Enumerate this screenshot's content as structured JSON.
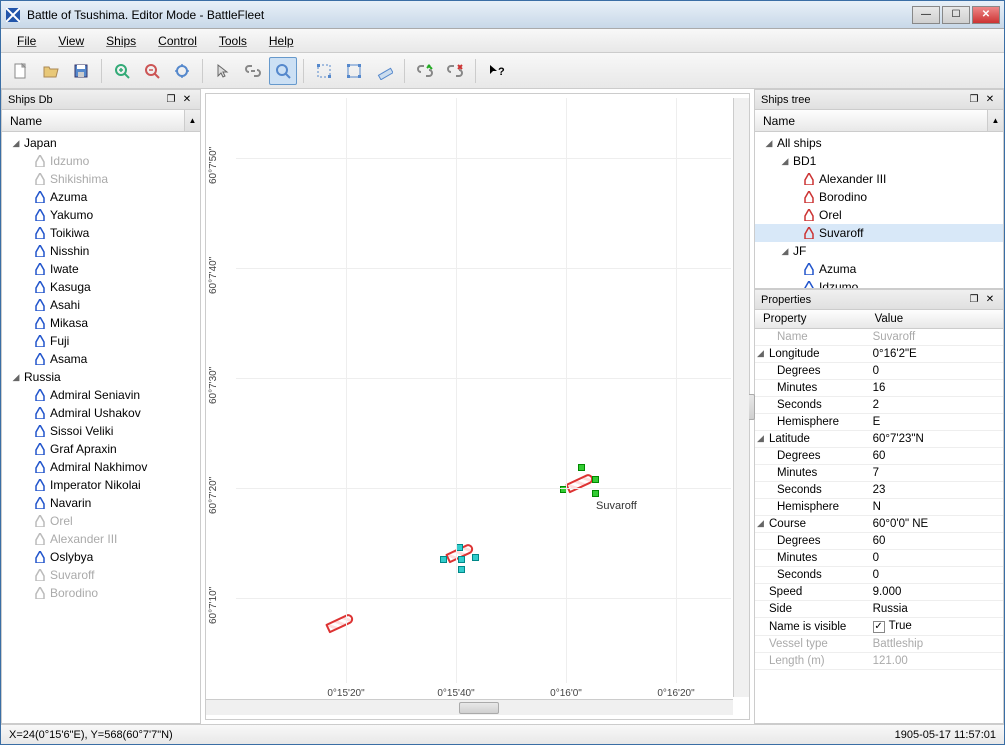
{
  "window": {
    "title": "Battle of Tsushima. Editor Mode - BattleFleet"
  },
  "menu": [
    "File",
    "View",
    "Ships",
    "Control",
    "Tools",
    "Help"
  ],
  "panels": {
    "ships_db": "Ships Db",
    "ships_tree": "Ships tree",
    "properties": "Properties",
    "col_name": "Name",
    "col_property": "Property",
    "col_value": "Value"
  },
  "ships_db": {
    "groups": [
      {
        "name": "Japan",
        "ships": [
          {
            "name": "Idzumo",
            "dim": true
          },
          {
            "name": "Shikishima",
            "dim": true
          },
          {
            "name": "Azuma",
            "dim": false
          },
          {
            "name": "Yakumo",
            "dim": false
          },
          {
            "name": "Toikiwa",
            "dim": false
          },
          {
            "name": "Nisshin",
            "dim": false
          },
          {
            "name": "Iwate",
            "dim": false
          },
          {
            "name": "Kasuga",
            "dim": false
          },
          {
            "name": "Asahi",
            "dim": false
          },
          {
            "name": "Mikasa",
            "dim": false
          },
          {
            "name": "Fuji",
            "dim": false
          },
          {
            "name": "Asama",
            "dim": false
          }
        ]
      },
      {
        "name": "Russia",
        "ships": [
          {
            "name": "Admiral Seniavin",
            "dim": false
          },
          {
            "name": "Admiral Ushakov",
            "dim": false
          },
          {
            "name": "Sissoi Veliki",
            "dim": false
          },
          {
            "name": "Graf Apraxin",
            "dim": false
          },
          {
            "name": "Admiral Nakhimov",
            "dim": false
          },
          {
            "name": "Imperator Nikolai",
            "dim": false
          },
          {
            "name": "Navarin",
            "dim": false
          },
          {
            "name": "Orel",
            "dim": true
          },
          {
            "name": "Alexander III",
            "dim": true
          },
          {
            "name": "Oslybya",
            "dim": false
          },
          {
            "name": "Suvaroff",
            "dim": true
          },
          {
            "name": "Borodino",
            "dim": true
          }
        ]
      }
    ]
  },
  "ships_tree": {
    "root": "All ships",
    "groups": [
      {
        "name": "BD1",
        "color": "red",
        "ships": [
          "Alexander III",
          "Borodino",
          "Orel",
          "Suvaroff"
        ],
        "selected": "Suvaroff"
      },
      {
        "name": "JF",
        "color": "blue",
        "ships": [
          "Azuma",
          "Idzumo"
        ]
      }
    ]
  },
  "properties": [
    {
      "k": "Name",
      "v": "Suvaroff",
      "dim": true,
      "indent": 1
    },
    {
      "k": "Longitude",
      "v": "0°16'2\"E",
      "group": true
    },
    {
      "k": "Degrees",
      "v": "0",
      "indent": 1
    },
    {
      "k": "Minutes",
      "v": "16",
      "indent": 1
    },
    {
      "k": "Seconds",
      "v": "2",
      "indent": 1
    },
    {
      "k": "Hemisphere",
      "v": "E",
      "indent": 1
    },
    {
      "k": "Latitude",
      "v": "60°7'23\"N",
      "group": true
    },
    {
      "k": "Degrees",
      "v": "60",
      "indent": 1
    },
    {
      "k": "Minutes",
      "v": "7",
      "indent": 1
    },
    {
      "k": "Seconds",
      "v": "23",
      "indent": 1
    },
    {
      "k": "Hemisphere",
      "v": "N",
      "indent": 1
    },
    {
      "k": "Course",
      "v": "60°0'0\" NE",
      "group": true
    },
    {
      "k": "Degrees",
      "v": "60",
      "indent": 1
    },
    {
      "k": "Minutes",
      "v": "0",
      "indent": 1
    },
    {
      "k": "Seconds",
      "v": "0",
      "indent": 1
    },
    {
      "k": "Speed",
      "v": "9.000"
    },
    {
      "k": "Side",
      "v": "Russia"
    },
    {
      "k": "Name is visible",
      "v": "True",
      "check": true
    },
    {
      "k": "Vessel type",
      "v": "Battleship",
      "dim": true
    },
    {
      "k": "Length (m)",
      "v": "121.00",
      "dim": true
    }
  ],
  "map": {
    "x_ticks": [
      "0°15'20\"",
      "0°15'40\"",
      "0°16'0\"",
      "0°16'20\""
    ],
    "y_ticks": [
      "60°7'50\"",
      "60°7'40\"",
      "60°7'30\"",
      "60°7'20\"",
      "60°7'10\""
    ],
    "selected_caption": "Suvaroff"
  },
  "status": {
    "coords": "X=24(0°15'6\"E), Y=568(60°7'7\"N)",
    "time": "1905-05-17 11:57:01"
  }
}
